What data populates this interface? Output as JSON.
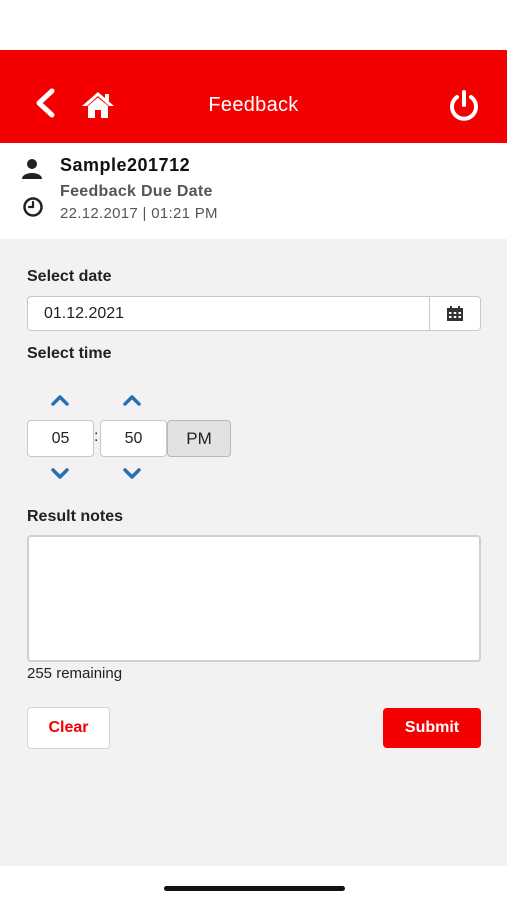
{
  "header": {
    "title": "Feedback",
    "background": "#f50000",
    "icons": [
      "chevron-left-icon",
      "home-icon",
      "power-icon"
    ]
  },
  "info": {
    "username": "Sample201712",
    "due_label": "Feedback Due Date",
    "due_value": "22.12.2017 | 01:21 PM",
    "icons": [
      "user-icon",
      "clock-icon"
    ]
  },
  "form": {
    "date_label": "Select date",
    "date_value": "01.12.2021",
    "time_label": "Select time",
    "hour": "05",
    "separator": ":",
    "minute": "50",
    "meridiem": "PM",
    "notes_label": "Result notes",
    "notes_value": "",
    "remaining": "255 remaining"
  },
  "actions": {
    "clear_label": "Clear",
    "submit_label": "Submit"
  },
  "colors": {
    "accent": "#f50000",
    "chevron": "#2a6fb0"
  }
}
